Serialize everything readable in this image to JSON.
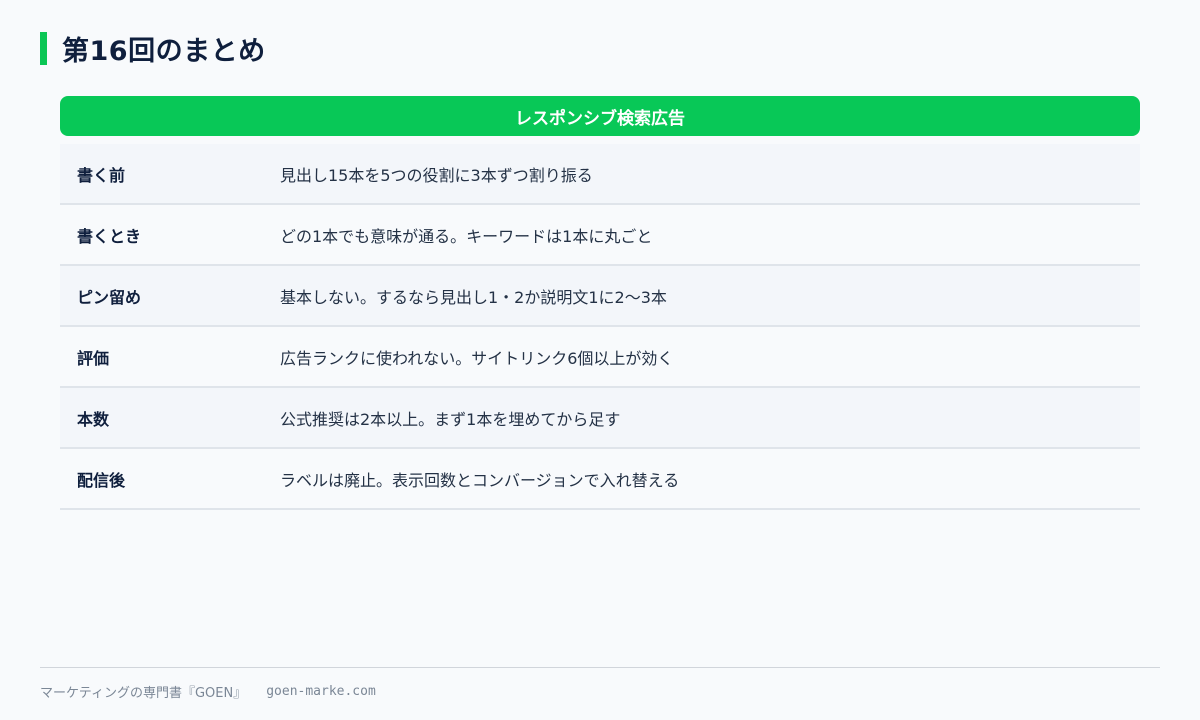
{
  "page": {
    "title": "第16回のまとめ"
  },
  "summary": {
    "header": "レスポンシブ検索広告",
    "rows": [
      {
        "label": "書く前",
        "value": "見出し15本を5つの役割に3本ずつ割り振る"
      },
      {
        "label": "書くとき",
        "value": "どの1本でも意味が通る。キーワードは1本に丸ごと"
      },
      {
        "label": "ピン留め",
        "value": "基本しない。するなら見出し1・2か説明文1に2〜3本"
      },
      {
        "label": "評価",
        "value": "広告ランクに使われない。サイトリンク6個以上が効く"
      },
      {
        "label": "本数",
        "value": "公式推奨は2本以上。まず1本を埋めてから足す"
      },
      {
        "label": "配信後",
        "value": "ラベルは廃止。表示回数とコンバージョンで入れ替える"
      }
    ]
  },
  "footer": {
    "brand": "マーケティングの専門書『GOEN』",
    "site": "goen-marke.com"
  },
  "colors": {
    "accent": "#08c857",
    "title": "#0f1f3d",
    "background": "#f8fafc"
  }
}
